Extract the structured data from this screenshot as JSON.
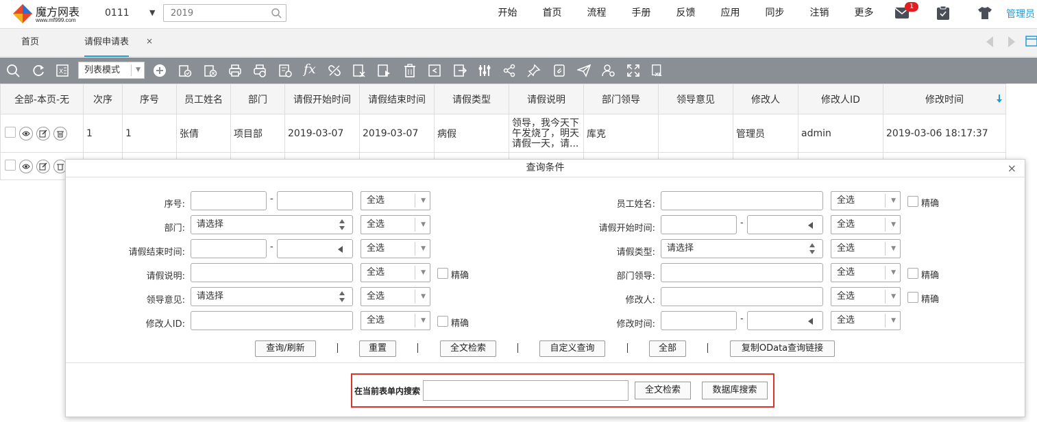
{
  "header": {
    "logo_name": "魔方网表",
    "logo_url": "www.mf999.com",
    "year_code": "0111",
    "search_placeholder": "2019",
    "nav": [
      "开始",
      "首页",
      "流程",
      "手册",
      "反馈",
      "应用",
      "同步",
      "注销",
      "更多"
    ],
    "mail_badge": "1",
    "user": "管理员"
  },
  "tabs": {
    "home": "首页",
    "active": "请假申请表",
    "close": "×"
  },
  "toolbar": {
    "mode": "列表模式",
    "fx_label": "fx"
  },
  "grid": {
    "columns": [
      "全部-本页-无",
      "次序",
      "序号",
      "员工姓名",
      "部门",
      "请假开始时间",
      "请假结束时间",
      "请假类型",
      "请假说明",
      "部门领导",
      "领导意见",
      "修改人",
      "修改人ID",
      "修改时间"
    ],
    "rows": [
      {
        "order": "1",
        "seq": "1",
        "name": "张倩",
        "dept": "项目部",
        "start": "2019-03-07",
        "end": "2019-03-07",
        "type": "病假",
        "desc": "领导，我今天下午发烧了，明天请假一天，请...",
        "leader": "库克",
        "opinion": "",
        "modifier": "管理员",
        "modifier_id": "admin",
        "modified": "2019-03-06 18:17:37"
      }
    ]
  },
  "dialog": {
    "title": "查询条件",
    "close": "×",
    "labels": {
      "seq": "序号:",
      "dept": "部门:",
      "end_time": "请假结束时间:",
      "desc": "请假说明:",
      "opinion": "领导意见:",
      "modifier_id": "修改人ID:",
      "name": "员工姓名:",
      "start_time": "请假开始时间:",
      "type": "请假类型:",
      "leader": "部门领导:",
      "modifier": "修改人:",
      "modified_time": "修改时间:"
    },
    "please_select": "请选择",
    "select_all": "全选",
    "exact": "精确",
    "dash": "-",
    "buttons": [
      "查询/刷新",
      "重置",
      "全文检索",
      "自定义查询",
      "全部",
      "复制OData查询链接"
    ],
    "bottom": {
      "label": "在当前表单内搜索",
      "fulltext_button": "全文检索",
      "db_button": "数据库搜索"
    }
  },
  "colors": {
    "toolbar_bg": "#8a8f96",
    "accent": "#1e9bd7",
    "link": "#0033aa",
    "highlight_border": "#e0302a",
    "badge": "#e02020"
  }
}
